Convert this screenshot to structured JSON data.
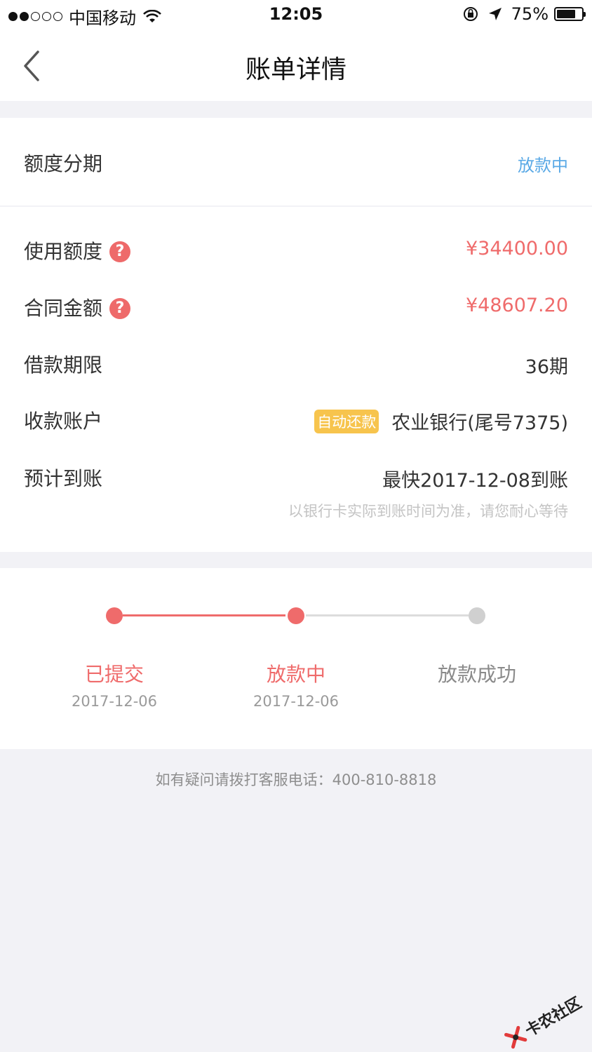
{
  "status_bar": {
    "carrier": "中国移动",
    "time": "12:05",
    "battery": "75%"
  },
  "nav": {
    "title": "账单详情"
  },
  "section_type": {
    "label": "额度分期",
    "status": "放款中"
  },
  "details": {
    "used_amount_label": "使用额度",
    "used_amount_value": "¥34400.00",
    "contract_amount_label": "合同金额",
    "contract_amount_value": "¥48607.20",
    "term_label": "借款期限",
    "term_value": "36期",
    "account_label": "收款账户",
    "account_tag": "自动还款",
    "account_value": "农业银行(尾号7375)",
    "arrival_label": "预计到账",
    "arrival_value": "最快2017-12-08到账",
    "arrival_note": "以银行卡实际到账时间为准，请您耐心等待",
    "help_icon": "?"
  },
  "progress": {
    "steps": [
      {
        "label": "已提交",
        "date": "2017-12-06"
      },
      {
        "label": "放款中",
        "date": "2017-12-06"
      },
      {
        "label": "放款成功",
        "date": ""
      }
    ]
  },
  "footer": {
    "note": "如有疑问请拨打客服电话：400-810-8818"
  },
  "watermark": {
    "text": "卡农社区"
  },
  "colors": {
    "accent_red": "#ef6b6b",
    "status_blue": "#5aa9e6",
    "tag_yellow": "#f7c44d",
    "inactive_grey": "#d0d0d0"
  }
}
